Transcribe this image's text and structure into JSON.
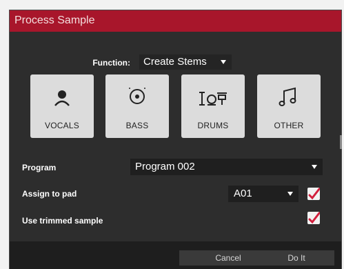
{
  "dialog": {
    "title": "Process Sample",
    "function_label": "Function:",
    "function_value": "Create Stems",
    "stems": [
      {
        "label": "VOCALS",
        "icon": "person-icon"
      },
      {
        "label": "BASS",
        "icon": "speaker-icon"
      },
      {
        "label": "DRUMS",
        "icon": "drum-kit-icon"
      },
      {
        "label": "OTHER",
        "icon": "music-notes-icon"
      }
    ],
    "program_label": "Program",
    "program_value": "Program 002",
    "assign_label": "Assign to pad",
    "assign_value": "A01",
    "assign_checked": true,
    "trimmed_label": "Use trimmed sample",
    "trimmed_checked": true,
    "cancel_label": "Cancel",
    "ok_label": "Do It"
  },
  "colors": {
    "title_bar": "#a8162b",
    "dialog_bg": "#2d2d2d",
    "stem_tile": "#dcdcdc",
    "check_mark": "#d21f3c"
  }
}
